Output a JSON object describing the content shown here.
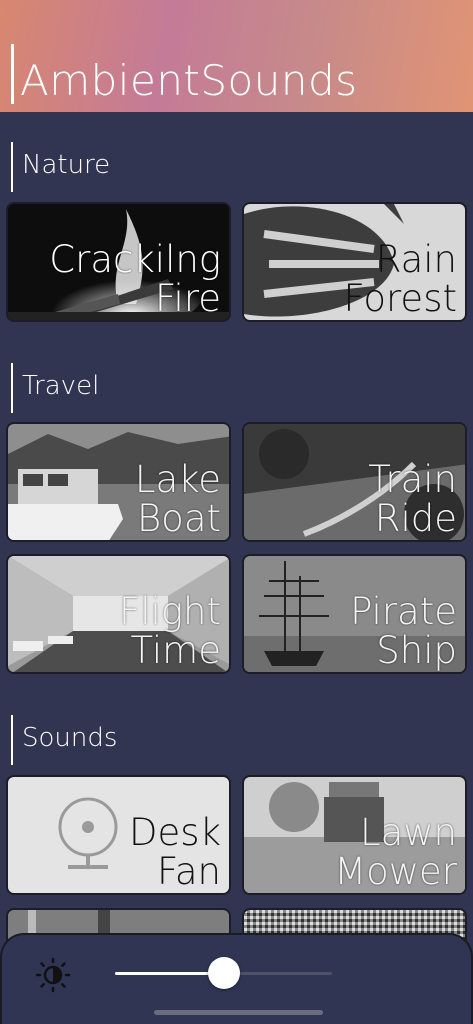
{
  "app": {
    "title": "AmbientSounds"
  },
  "sections": [
    {
      "title": "Nature",
      "cards": [
        {
          "line1": "Crackilng",
          "line2": "Fire"
        },
        {
          "line1": "Rain",
          "line2": "Forest"
        }
      ]
    },
    {
      "title": "Travel",
      "cards": [
        {
          "line1": "Lake",
          "line2": "Boat"
        },
        {
          "line1": "Train",
          "line2": "Ride"
        },
        {
          "line1": "Flight",
          "line2": "Time"
        },
        {
          "line1": "Pirate",
          "line2": "Ship"
        }
      ]
    },
    {
      "title": "Sounds",
      "cards": [
        {
          "line1": "Desk",
          "line2": "Fan"
        },
        {
          "line1": "Lawn",
          "line2": "Mower"
        }
      ]
    }
  ],
  "brightness": {
    "icon": "brightness-icon",
    "level": 0.5
  },
  "colors": {
    "background": "#323552",
    "header_gradient_start": "#d8876f",
    "header_gradient_mid": "#c47b97"
  }
}
